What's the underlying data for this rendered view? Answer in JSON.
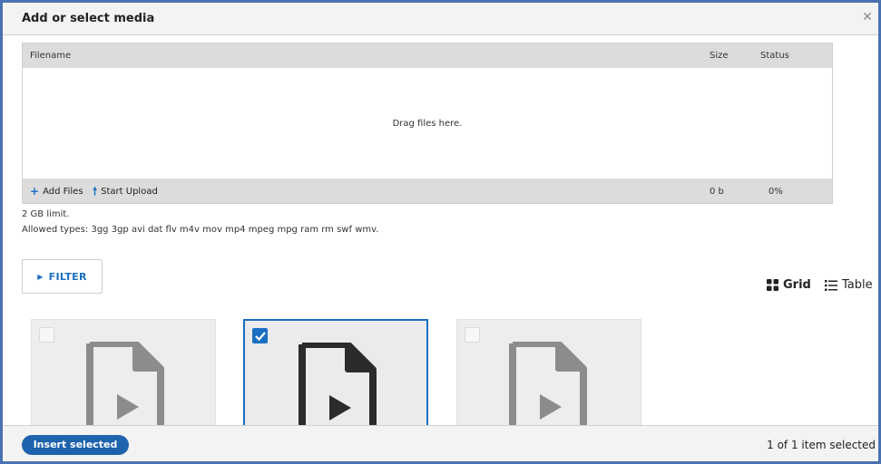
{
  "dialog": {
    "title": "Add or select media",
    "close_icon": "close-icon"
  },
  "uploader": {
    "columns": {
      "filename": "Filename",
      "size": "Size",
      "status": "Status"
    },
    "drop_text": "Drag files here.",
    "add_files_label": "Add Files",
    "start_upload_label": "Start Upload",
    "total_size": "0 b",
    "total_status": "0%"
  },
  "limits": {
    "size_limit": "2 GB limit.",
    "allowed_types": "Allowed types: 3gg 3gp avi dat flv m4v mov mp4 mpeg mpg ram rm swf wmv."
  },
  "filter": {
    "label": "FILTER"
  },
  "view_switch": {
    "grid_label": "Grid",
    "table_label": "Table",
    "active": "Grid"
  },
  "media_items": [
    {
      "icon": "video-file-icon",
      "checked": false
    },
    {
      "icon": "video-file-icon",
      "checked": true
    },
    {
      "icon": "video-file-icon",
      "checked": false
    }
  ],
  "footer": {
    "insert_label": "Insert selected",
    "selection_count": "1 of 1 item selected"
  },
  "colors": {
    "accent": "#1a6fc2",
    "button": "#1d63ad",
    "frame": "#4a72b2",
    "icon_inactive": "#8c8c8c",
    "icon_active": "#2b2b2b"
  }
}
